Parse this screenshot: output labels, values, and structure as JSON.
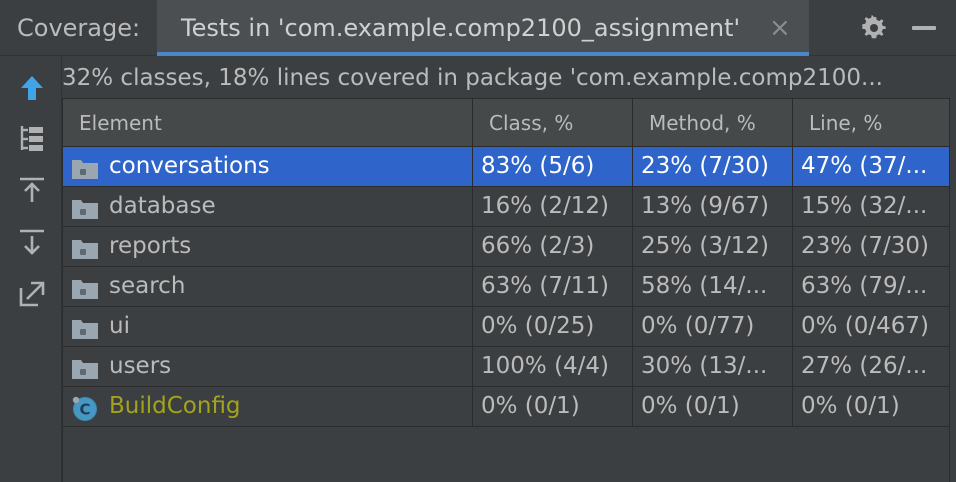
{
  "header": {
    "title": "Coverage:",
    "tab_label": "Tests in 'com.example.comp2100_assignment'",
    "tab_close": "×"
  },
  "icons": {
    "gear": "gear-icon",
    "minimize": "minimize-icon",
    "toolbar": [
      "up-arrow-icon",
      "flatten-packages-icon",
      "import-icon",
      "export-icon",
      "open-external-icon"
    ]
  },
  "summary": "32% classes, 18% lines covered in package 'com.example.comp2100...",
  "table": {
    "columns": [
      "Element",
      "Class, %",
      "Method, %",
      "Line, %"
    ],
    "rows": [
      {
        "name": "conversations",
        "kind": "package",
        "cls": "83% (5/6)",
        "method": "23% (7/30)",
        "line": "47% (37/...",
        "selected": true
      },
      {
        "name": "database",
        "kind": "package",
        "cls": "16% (2/12)",
        "method": "13% (9/67)",
        "line": "15% (32/...",
        "selected": false
      },
      {
        "name": "reports",
        "kind": "package",
        "cls": "66% (2/3)",
        "method": "25% (3/12)",
        "line": "23% (7/30)",
        "selected": false
      },
      {
        "name": "search",
        "kind": "package",
        "cls": "63% (7/11)",
        "method": "58% (14/...",
        "line": "63% (79/...",
        "selected": false
      },
      {
        "name": "ui",
        "kind": "package",
        "cls": "0% (0/25)",
        "method": "0% (0/77)",
        "line": "0% (0/467)",
        "selected": false
      },
      {
        "name": "users",
        "kind": "package",
        "cls": "100% (4/4)",
        "method": "30% (13/...",
        "line": "27% (26/...",
        "selected": false
      },
      {
        "name": "BuildConfig",
        "kind": "class",
        "cls": "0% (0/1)",
        "method": "0% (0/1)",
        "line": "0% (0/1)",
        "selected": false
      }
    ]
  },
  "colors": {
    "accent": "#4a88c7",
    "selection": "#2f65ca",
    "class_name": "#a3a31c",
    "arrow_icon": "#3fa5e8"
  }
}
